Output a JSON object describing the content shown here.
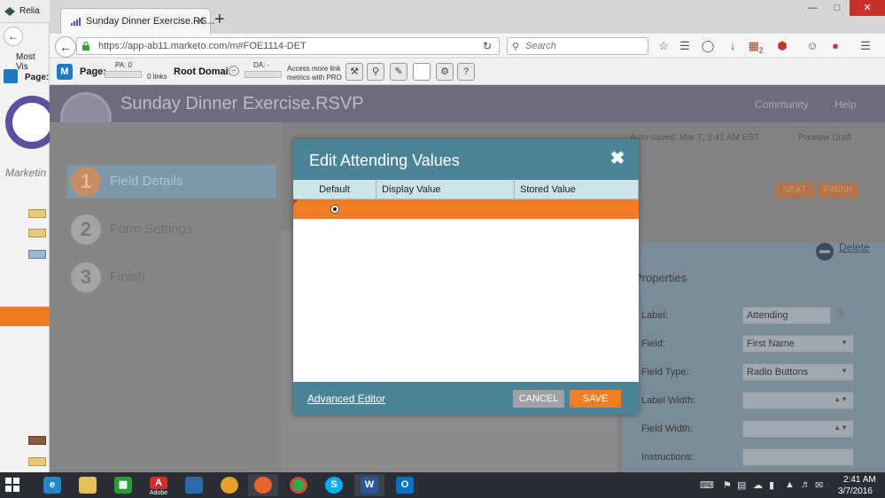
{
  "background_window": {
    "tab_title": "Relia",
    "bookmark_label": "Most Vis",
    "page_label": "Page:",
    "marketing_label": "Marketin"
  },
  "browser": {
    "tab_title": "Sunday Dinner Exercise.RS...",
    "url": "https://app-ab11.marketo.com/m#FOE1114-DET",
    "search_placeholder": "Search",
    "badge_count": "2"
  },
  "marketo_toolbar": {
    "page_label": "Page:",
    "pa_label": "PA: 0",
    "links_label": "0 links",
    "root_domain_label": "Root Domain:",
    "da_label": "DA: -",
    "access_text_line1": "Access more link",
    "access_text_line2": "metrics with PRO"
  },
  "app": {
    "title": "Sunday Dinner Exercise.RSVP",
    "community": "Community",
    "help": "Help",
    "autosaved": "Auto-saved: Mar 7, 2:41 AM EST",
    "preview_draft": "Preview Draft",
    "next": "NEXT",
    "finish": "FINISH",
    "delete": "Delete",
    "properties": "Properties",
    "steps": [
      {
        "number": "1",
        "label": "Field Details"
      },
      {
        "number": "2",
        "label": "Form Settings"
      },
      {
        "number": "3",
        "label": "Finish"
      }
    ],
    "props": [
      {
        "label": "Label:",
        "value": "Attending"
      },
      {
        "label": "Field:",
        "value": "First Name"
      },
      {
        "label": "Field Type:",
        "value": "Radio Buttons"
      },
      {
        "label": "Label Width:",
        "value": ""
      },
      {
        "label": "Field Width:",
        "value": ""
      },
      {
        "label": "Instructions:",
        "value": ""
      }
    ]
  },
  "modal": {
    "title": "Edit Attending Values",
    "columns": [
      "Default",
      "Display Value",
      "Stored Value"
    ],
    "rows": [
      {
        "default": true,
        "display_value": "",
        "stored_value": ""
      }
    ],
    "advanced_editor": "Advanced Editor",
    "cancel": "CANCEL",
    "save": "SAVE"
  },
  "taskbar": {
    "adobe_caption": "Adobe",
    "time": "2:41 AM",
    "date": "3/7/2016"
  },
  "colors": {
    "modal_header": "#4c8497",
    "accent_orange": "#f07d23",
    "grid_header": "#cce3ea",
    "cancel_gray": "#9fa1a4"
  }
}
